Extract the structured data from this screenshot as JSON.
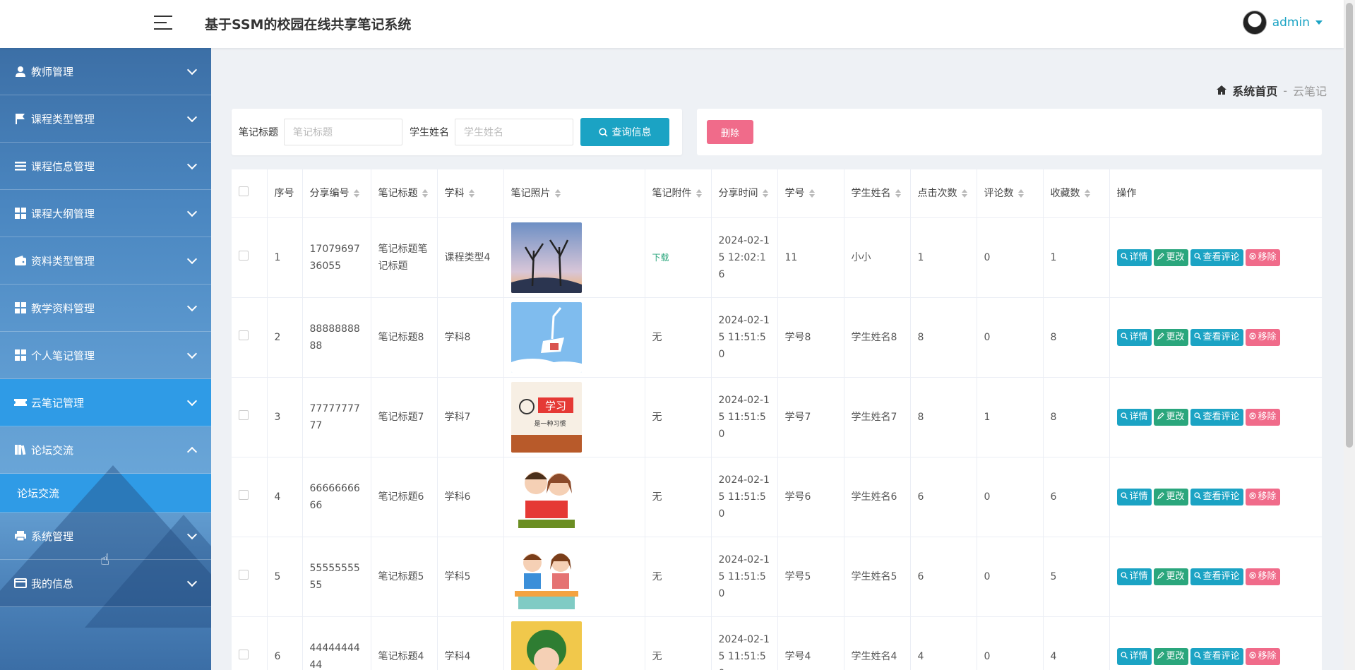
{
  "header": {
    "title": "基于SSM的校园在线共享笔记系统",
    "username": "admin"
  },
  "sidebar": {
    "items": [
      {
        "label": "教师管理",
        "icon": "user-icon"
      },
      {
        "label": "课程类型管理",
        "icon": "flag-icon"
      },
      {
        "label": "课程信息管理",
        "icon": "list-icon"
      },
      {
        "label": "课程大纲管理",
        "icon": "grid-icon"
      },
      {
        "label": "资料类型管理",
        "icon": "wallet-icon"
      },
      {
        "label": "教学资料管理",
        "icon": "grid-icon"
      },
      {
        "label": "个人笔记管理",
        "icon": "grid-icon"
      },
      {
        "label": "云笔记管理",
        "icon": "ticket-icon",
        "active": true
      },
      {
        "label": "论坛交流",
        "icon": "book-icon",
        "expanded": true
      },
      {
        "label": "系统管理",
        "icon": "printer-icon"
      },
      {
        "label": "我的信息",
        "icon": "card-icon"
      }
    ],
    "submenu": {
      "label": "论坛交流"
    }
  },
  "breadcrumb": {
    "home": "系统首页",
    "separator": "-",
    "current": "云笔记"
  },
  "search": {
    "title_label": "笔记标题",
    "title_placeholder": "笔记标题",
    "name_label": "学生姓名",
    "name_placeholder": "学生姓名",
    "button_label": "查询信息"
  },
  "actions": {
    "delete_label": "删除"
  },
  "table": {
    "headers": [
      "序号",
      "分享编号",
      "笔记标题",
      "学科",
      "笔记照片",
      "笔记附件",
      "分享时间",
      "学号",
      "学生姓名",
      "点击次数",
      "评论数",
      "收藏数",
      "操作"
    ],
    "op_labels": {
      "detail": "详情",
      "edit": "更改",
      "comments": "查看评论",
      "remove": "移除"
    },
    "rows": [
      {
        "idx": "1",
        "code": "1707969736055",
        "title": "笔记标题笔记标题",
        "subject": "课程类型4",
        "photo": "trees-photo",
        "attachment": "下载",
        "time": "2024-02-15 12:02:16",
        "sid": "11",
        "name": "小小",
        "clicks": "1",
        "comments": "0",
        "favs": "1"
      },
      {
        "idx": "2",
        "code": "8888888888",
        "title": "笔记标题8",
        "subject": "学科8",
        "photo": "book-sky-photo",
        "attachment": "无",
        "time": "2024-02-15 11:51:50",
        "sid": "学号8",
        "name": "学生姓名8",
        "clicks": "8",
        "comments": "0",
        "favs": "8"
      },
      {
        "idx": "3",
        "code": "7777777777",
        "title": "笔记标题7",
        "subject": "学科7",
        "photo": "study-poster-photo",
        "attachment": "无",
        "time": "2024-02-15 11:51:50",
        "sid": "学号7",
        "name": "学生姓名7",
        "clicks": "8",
        "comments": "1",
        "favs": "8"
      },
      {
        "idx": "4",
        "code": "6666666666",
        "title": "笔记标题6",
        "subject": "学科6",
        "photo": "kids-reading-photo",
        "attachment": "无",
        "time": "2024-02-15 11:51:50",
        "sid": "学号6",
        "name": "学生姓名6",
        "clicks": "6",
        "comments": "0",
        "favs": "6"
      },
      {
        "idx": "5",
        "code": "5555555555",
        "title": "笔记标题5",
        "subject": "学科5",
        "photo": "kids-desk-photo",
        "attachment": "无",
        "time": "2024-02-15 11:51:50",
        "sid": "学号5",
        "name": "学生姓名5",
        "clicks": "6",
        "comments": "0",
        "favs": "5"
      },
      {
        "idx": "6",
        "code": "4444444444",
        "title": "笔记标题4",
        "subject": "学科4",
        "photo": "boy-reading-photo",
        "attachment": "无",
        "time": "2024-02-15 11:51:50",
        "sid": "学号4",
        "name": "学生姓名4",
        "clicks": "4",
        "comments": "0",
        "favs": "4"
      }
    ]
  },
  "colors": {
    "teal": "#1ba3c4",
    "green": "#2aa67c",
    "pink": "#f06b8a",
    "active_menu": "#2f9be6"
  }
}
